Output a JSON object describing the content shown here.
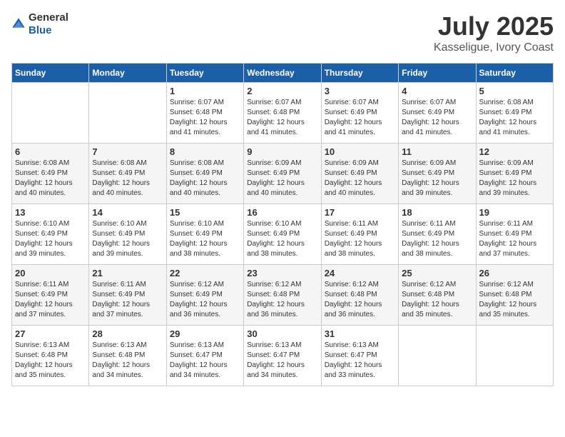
{
  "header": {
    "logo_general": "General",
    "logo_blue": "Blue",
    "month": "July 2025",
    "location": "Kasseligue, Ivory Coast"
  },
  "weekdays": [
    "Sunday",
    "Monday",
    "Tuesday",
    "Wednesday",
    "Thursday",
    "Friday",
    "Saturday"
  ],
  "weeks": [
    [
      {
        "day": "",
        "sunrise": "",
        "sunset": "",
        "daylight": ""
      },
      {
        "day": "",
        "sunrise": "",
        "sunset": "",
        "daylight": ""
      },
      {
        "day": "1",
        "sunrise": "Sunrise: 6:07 AM",
        "sunset": "Sunset: 6:48 PM",
        "daylight": "Daylight: 12 hours and 41 minutes."
      },
      {
        "day": "2",
        "sunrise": "Sunrise: 6:07 AM",
        "sunset": "Sunset: 6:48 PM",
        "daylight": "Daylight: 12 hours and 41 minutes."
      },
      {
        "day": "3",
        "sunrise": "Sunrise: 6:07 AM",
        "sunset": "Sunset: 6:49 PM",
        "daylight": "Daylight: 12 hours and 41 minutes."
      },
      {
        "day": "4",
        "sunrise": "Sunrise: 6:07 AM",
        "sunset": "Sunset: 6:49 PM",
        "daylight": "Daylight: 12 hours and 41 minutes."
      },
      {
        "day": "5",
        "sunrise": "Sunrise: 6:08 AM",
        "sunset": "Sunset: 6:49 PM",
        "daylight": "Daylight: 12 hours and 41 minutes."
      }
    ],
    [
      {
        "day": "6",
        "sunrise": "Sunrise: 6:08 AM",
        "sunset": "Sunset: 6:49 PM",
        "daylight": "Daylight: 12 hours and 40 minutes."
      },
      {
        "day": "7",
        "sunrise": "Sunrise: 6:08 AM",
        "sunset": "Sunset: 6:49 PM",
        "daylight": "Daylight: 12 hours and 40 minutes."
      },
      {
        "day": "8",
        "sunrise": "Sunrise: 6:08 AM",
        "sunset": "Sunset: 6:49 PM",
        "daylight": "Daylight: 12 hours and 40 minutes."
      },
      {
        "day": "9",
        "sunrise": "Sunrise: 6:09 AM",
        "sunset": "Sunset: 6:49 PM",
        "daylight": "Daylight: 12 hours and 40 minutes."
      },
      {
        "day": "10",
        "sunrise": "Sunrise: 6:09 AM",
        "sunset": "Sunset: 6:49 PM",
        "daylight": "Daylight: 12 hours and 40 minutes."
      },
      {
        "day": "11",
        "sunrise": "Sunrise: 6:09 AM",
        "sunset": "Sunset: 6:49 PM",
        "daylight": "Daylight: 12 hours and 39 minutes."
      },
      {
        "day": "12",
        "sunrise": "Sunrise: 6:09 AM",
        "sunset": "Sunset: 6:49 PM",
        "daylight": "Daylight: 12 hours and 39 minutes."
      }
    ],
    [
      {
        "day": "13",
        "sunrise": "Sunrise: 6:10 AM",
        "sunset": "Sunset: 6:49 PM",
        "daylight": "Daylight: 12 hours and 39 minutes."
      },
      {
        "day": "14",
        "sunrise": "Sunrise: 6:10 AM",
        "sunset": "Sunset: 6:49 PM",
        "daylight": "Daylight: 12 hours and 39 minutes."
      },
      {
        "day": "15",
        "sunrise": "Sunrise: 6:10 AM",
        "sunset": "Sunset: 6:49 PM",
        "daylight": "Daylight: 12 hours and 38 minutes."
      },
      {
        "day": "16",
        "sunrise": "Sunrise: 6:10 AM",
        "sunset": "Sunset: 6:49 PM",
        "daylight": "Daylight: 12 hours and 38 minutes."
      },
      {
        "day": "17",
        "sunrise": "Sunrise: 6:11 AM",
        "sunset": "Sunset: 6:49 PM",
        "daylight": "Daylight: 12 hours and 38 minutes."
      },
      {
        "day": "18",
        "sunrise": "Sunrise: 6:11 AM",
        "sunset": "Sunset: 6:49 PM",
        "daylight": "Daylight: 12 hours and 38 minutes."
      },
      {
        "day": "19",
        "sunrise": "Sunrise: 6:11 AM",
        "sunset": "Sunset: 6:49 PM",
        "daylight": "Daylight: 12 hours and 37 minutes."
      }
    ],
    [
      {
        "day": "20",
        "sunrise": "Sunrise: 6:11 AM",
        "sunset": "Sunset: 6:49 PM",
        "daylight": "Daylight: 12 hours and 37 minutes."
      },
      {
        "day": "21",
        "sunrise": "Sunrise: 6:11 AM",
        "sunset": "Sunset: 6:49 PM",
        "daylight": "Daylight: 12 hours and 37 minutes."
      },
      {
        "day": "22",
        "sunrise": "Sunrise: 6:12 AM",
        "sunset": "Sunset: 6:49 PM",
        "daylight": "Daylight: 12 hours and 36 minutes."
      },
      {
        "day": "23",
        "sunrise": "Sunrise: 6:12 AM",
        "sunset": "Sunset: 6:48 PM",
        "daylight": "Daylight: 12 hours and 36 minutes."
      },
      {
        "day": "24",
        "sunrise": "Sunrise: 6:12 AM",
        "sunset": "Sunset: 6:48 PM",
        "daylight": "Daylight: 12 hours and 36 minutes."
      },
      {
        "day": "25",
        "sunrise": "Sunrise: 6:12 AM",
        "sunset": "Sunset: 6:48 PM",
        "daylight": "Daylight: 12 hours and 35 minutes."
      },
      {
        "day": "26",
        "sunrise": "Sunrise: 6:12 AM",
        "sunset": "Sunset: 6:48 PM",
        "daylight": "Daylight: 12 hours and 35 minutes."
      }
    ],
    [
      {
        "day": "27",
        "sunrise": "Sunrise: 6:13 AM",
        "sunset": "Sunset: 6:48 PM",
        "daylight": "Daylight: 12 hours and 35 minutes."
      },
      {
        "day": "28",
        "sunrise": "Sunrise: 6:13 AM",
        "sunset": "Sunset: 6:48 PM",
        "daylight": "Daylight: 12 hours and 34 minutes."
      },
      {
        "day": "29",
        "sunrise": "Sunrise: 6:13 AM",
        "sunset": "Sunset: 6:47 PM",
        "daylight": "Daylight: 12 hours and 34 minutes."
      },
      {
        "day": "30",
        "sunrise": "Sunrise: 6:13 AM",
        "sunset": "Sunset: 6:47 PM",
        "daylight": "Daylight: 12 hours and 34 minutes."
      },
      {
        "day": "31",
        "sunrise": "Sunrise: 6:13 AM",
        "sunset": "Sunset: 6:47 PM",
        "daylight": "Daylight: 12 hours and 33 minutes."
      },
      {
        "day": "",
        "sunrise": "",
        "sunset": "",
        "daylight": ""
      },
      {
        "day": "",
        "sunrise": "",
        "sunset": "",
        "daylight": ""
      }
    ]
  ]
}
